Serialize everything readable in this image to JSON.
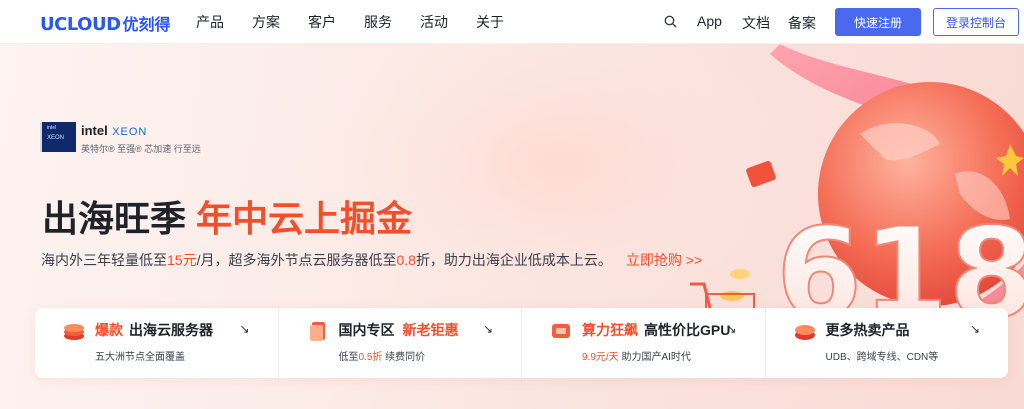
{
  "header": {
    "logo_en": "UCLOUD",
    "logo_cn": "优刻得",
    "nav": [
      "产品",
      "方案",
      "客户",
      "服务",
      "活动",
      "关于"
    ],
    "app_label": "App",
    "docs_label": "文档",
    "beian_label": "备案",
    "register_label": "快速注册",
    "console_label": "登录控制台"
  },
  "hero": {
    "intel_box_l1": "intel",
    "intel_box_l2": "XEON",
    "intel_brand": "intel",
    "intel_xeon": "XEON",
    "intel_sub": "英特尔® 至强® 芯加速 行至远",
    "headline_1": "出海旺季",
    "headline_2": "年中云上掘金",
    "sub_1": "海内外三年轻量低至",
    "sub_price1": "15元",
    "sub_2": "/月，超多海外节点云服务器低至",
    "sub_price2": "0.8",
    "sub_3": "折，助力出海企业低成本上云。",
    "cta": "立即抢购 >>",
    "promo_number": "618"
  },
  "cards": [
    {
      "tag": "爆款",
      "title": "出海云服务器",
      "sub_hl": "",
      "sub": "五大洲节点全面覆盖",
      "icon": "server-stack-icon"
    },
    {
      "tag": "",
      "title": "国内专区",
      "title_tag": "新老钜惠",
      "sub_pre": "低至",
      "sub_hl": "0.5折",
      "sub": " 续费同价",
      "icon": "document-icon"
    },
    {
      "tag": "算力狂飙",
      "title": "高性价比GPU",
      "sub_hl": "9.9元/天",
      "sub": " 助力国产AI时代",
      "icon": "gpu-icon"
    },
    {
      "tag": "",
      "title": "更多热卖产品",
      "sub_hl": "",
      "sub": "UDB、跨域专线、CDN等",
      "icon": "layers-icon"
    }
  ],
  "colors": {
    "brand": "#2b56f5",
    "accent": "#f2502d",
    "register_bg": "#4a69ef"
  }
}
